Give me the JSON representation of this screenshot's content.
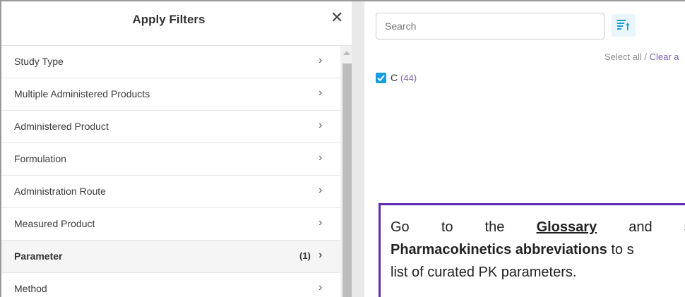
{
  "filters_panel": {
    "title": "Apply Filters",
    "close_symbol": "✕",
    "items": [
      {
        "label": "Study Type",
        "count": "",
        "active": false
      },
      {
        "label": "Multiple Administered Products",
        "count": "",
        "active": false
      },
      {
        "label": "Administered Product",
        "count": "",
        "active": false
      },
      {
        "label": "Formulation",
        "count": "",
        "active": false
      },
      {
        "label": "Administration Route",
        "count": "",
        "active": false
      },
      {
        "label": "Measured Product",
        "count": "",
        "active": false
      },
      {
        "label": "Parameter",
        "count": "(1)",
        "active": true
      },
      {
        "label": "Method",
        "count": "",
        "active": false
      }
    ],
    "chevron": "›"
  },
  "values_panel": {
    "search_placeholder": "Search",
    "sort_icon": "sort-ascending-icon",
    "select_all": "Select all",
    "separator": "/",
    "clear_all": "Clear a",
    "options": [
      {
        "label": "C",
        "count": "(44)",
        "checked": true
      }
    ]
  },
  "callout": {
    "line1_words": [
      "Go",
      "to",
      "the"
    ],
    "glossary": "Glossary",
    "and": "and",
    "line1_tail": "s",
    "abbrev": "Pharmacokinetics abbreviations",
    "line2_tail": "to s",
    "line3": "list of curated PK parameters."
  },
  "colors": {
    "accent": "#1a9ce0",
    "link": "#7b62b4",
    "callout_border": "#5b2bb0"
  }
}
